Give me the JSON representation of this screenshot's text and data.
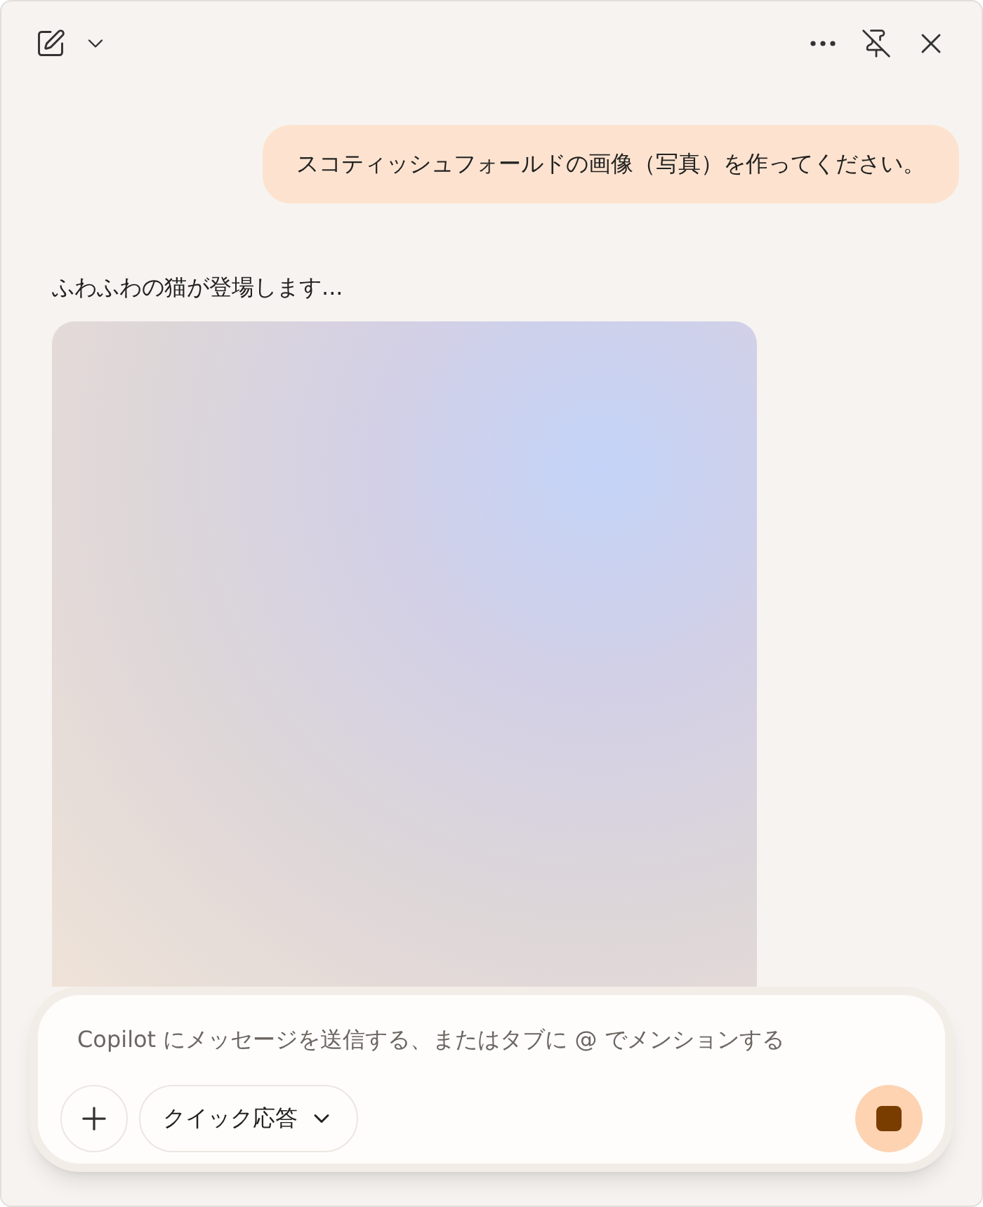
{
  "messages": [
    {
      "kind": "user",
      "text": "スコティッシュフォールドの画像（写真）を作ってください。"
    },
    {
      "kind": "assistant",
      "text": "ふわふわの猫が登場します...",
      "image": {
        "kind": "loading"
      }
    }
  ],
  "composer": {
    "placeholder": "Copilot にメッセージを送信する、またはタブに @ でメンションする",
    "mode": "クイック応答",
    "generating": true
  }
}
